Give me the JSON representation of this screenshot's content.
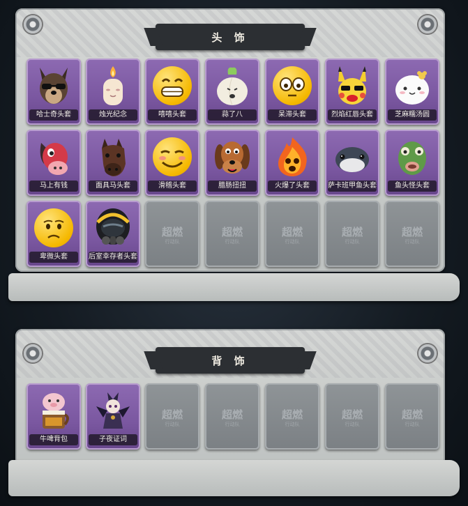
{
  "head_section": {
    "title": "头 饰",
    "items": [
      {
        "label": "哈士奇头套",
        "icon": "husky-head-icon"
      },
      {
        "label": "烛光纪念",
        "icon": "candle-head-icon"
      },
      {
        "label": "嘻嘻头套",
        "icon": "grin-emoji-icon"
      },
      {
        "label": "蒜了八",
        "icon": "garlic-head-icon"
      },
      {
        "label": "呆滞头套",
        "icon": "blank-face-emoji-icon"
      },
      {
        "label": "烈焰红唇头套",
        "icon": "pikachu-head-icon"
      },
      {
        "label": "芝麻糯汤圆",
        "icon": "dumpling-head-icon"
      },
      {
        "label": "马上有钱",
        "icon": "red-horse-head-icon"
      },
      {
        "label": "面具马头套",
        "icon": "horse-mask-icon"
      },
      {
        "label": "滑稽头套",
        "icon": "funny-emoji-icon"
      },
      {
        "label": "腊肠扭扭",
        "icon": "dachshund-head-icon"
      },
      {
        "label": "火爆了头套",
        "icon": "fire-head-icon"
      },
      {
        "label": "萨卡班甲鱼头套",
        "icon": "fish-head-icon"
      },
      {
        "label": "鱼头怪头套",
        "icon": "fishman-head-icon"
      },
      {
        "label": "卑微头套",
        "icon": "humble-emoji-icon"
      },
      {
        "label": "后室幸存者头套",
        "icon": "gas-mask-helmet-icon"
      }
    ],
    "locked_count": 5,
    "locked_watermark": "超燃",
    "locked_sub": "行动队"
  },
  "back_section": {
    "title": "背 饰",
    "items": [
      {
        "label": "牛啤背包",
        "icon": "beer-backpack-icon"
      },
      {
        "label": "子夜证词",
        "icon": "raven-doll-icon"
      }
    ],
    "locked_count": 5,
    "locked_watermark": "超燃",
    "locked_sub": "行动队"
  },
  "colors": {
    "item_purple": "#7a57a0",
    "locked_gray": "#858a8e",
    "panel": "#cfd2d0",
    "title_bar": "#2c2f33"
  }
}
